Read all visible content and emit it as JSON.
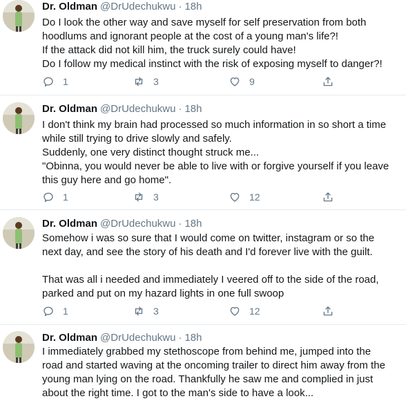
{
  "colors": {
    "text": "#14171a",
    "secondary": "#657786",
    "divider": "#e6ecf0"
  },
  "tweets": [
    {
      "name": "Dr. Oldman",
      "handle": "@DrUdechukwu",
      "separator": "·",
      "time": "18h",
      "lines": [
        "Do I look the other way and save myself for self preservation from both",
        "hoodlums and ignorant people at the cost of a young man's life?!",
        "If the attack did not kill him, the truck surely could have!",
        "Do I follow my medical instinct with the risk of exposing myself to danger?!"
      ],
      "replies": "1",
      "retweets": "3",
      "likes": "9"
    },
    {
      "name": "Dr. Oldman",
      "handle": "@DrUdechukwu",
      "separator": "·",
      "time": "18h",
      "lines": [
        "I don't think my brain had processed so much information in so short a time",
        "while still trying to drive slowly and safely.",
        "Suddenly, one very distinct thought struck me...",
        "\"Obinna, you would never be able to live with or forgive yourself if you leave",
        "this guy here and go home\"."
      ],
      "replies": "1",
      "retweets": "3",
      "likes": "12"
    },
    {
      "name": "Dr. Oldman",
      "handle": "@DrUdechukwu",
      "separator": "·",
      "time": "18h",
      "lines": [
        "Somehow i was so sure that I would come on twitter, instagram or so the",
        "next day, and see the story of his death and I'd forever live with the guilt.",
        "",
        "That was all i needed and immediately I veered off to the side of the road,",
        "parked and put on my hazard lights in one full swoop"
      ],
      "replies": "1",
      "retweets": "3",
      "likes": "12"
    },
    {
      "name": "Dr. Oldman",
      "handle": "@DrUdechukwu",
      "separator": "·",
      "time": "18h",
      "lines": [
        "I immediately grabbed my stethoscope from behind me, jumped into the",
        "road and started waving at the oncoming trailer to direct him away from the",
        "young man lying on the road. Thankfully he saw me and complied in just",
        "about the right time. I got to the man's side to have a look..."
      ]
    }
  ]
}
